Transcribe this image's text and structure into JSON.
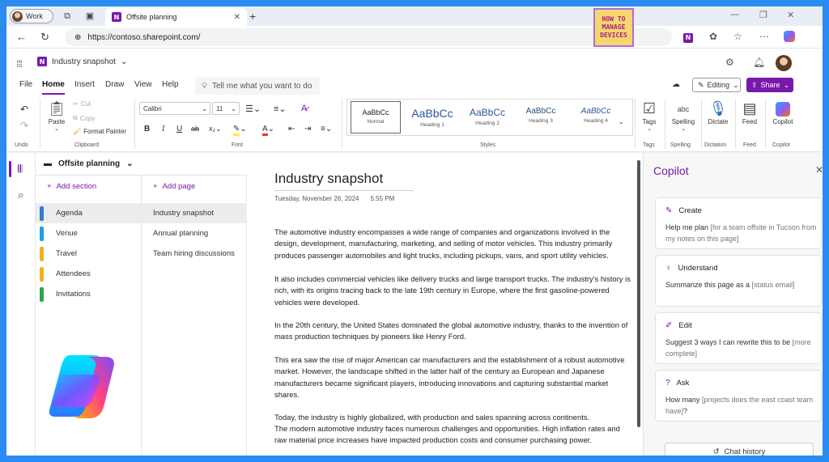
{
  "browser": {
    "profile_label": "Work",
    "tab_title": "Offsite planning",
    "url": "https://contoso.sharepoint.com/"
  },
  "watermark": {
    "line1": "HOW TO",
    "line2": "MANAGE",
    "line3": "DEVICES"
  },
  "app": {
    "title": "Industry snapshot",
    "menus": [
      "File",
      "Home",
      "Insert",
      "Draw",
      "View",
      "Help"
    ],
    "tell_me_placeholder": "Tell me what you want to do",
    "editing_label": "Editing",
    "share_label": "Share"
  },
  "ribbon": {
    "undo_group": "Undo",
    "paste_label": "Paste",
    "cut_label": "Cut",
    "copy_label": "Copy",
    "format_painter_label": "Format Painter",
    "clipboard_group": "Clipboard",
    "font_name": "Calibri",
    "font_size": "11",
    "font_group": "Font",
    "styles": [
      {
        "preview": "AaBbCc",
        "name": "Normal"
      },
      {
        "preview": "AaBbCc",
        "name": "Heading 1"
      },
      {
        "preview": "AaBbCc",
        "name": "Heading 2"
      },
      {
        "preview": "AaBbCc",
        "name": "Heading 3"
      },
      {
        "preview": "AaBbCc",
        "name": "Heading 4"
      }
    ],
    "styles_group": "Styles",
    "tags_label": "Tags",
    "tags_group": "Tags",
    "spelling_label": "Spelling",
    "spelling_group": "Spelling",
    "dictate_label": "Dictate",
    "dictation_group": "Dictation",
    "feed_label": "Feed",
    "feed_group": "Feed",
    "copilot_label": "Copilot",
    "copilot_group": "Copilot",
    "abc_text": "abc"
  },
  "notebook": {
    "name": "Offsite planning",
    "add_section": "Add section",
    "add_page": "Add page",
    "sections": [
      {
        "label": "Agenda",
        "color": "#2d7fd0"
      },
      {
        "label": "Venue",
        "color": "#1ba1e2"
      },
      {
        "label": "Travel",
        "color": "#f2b01e"
      },
      {
        "label": "Attendees",
        "color": "#f2b01e"
      },
      {
        "label": "Invitations",
        "color": "#2ea44f"
      }
    ],
    "pages": [
      "Industry snapshot",
      "Annual planning",
      "Team hiring discussions"
    ]
  },
  "page": {
    "title": "Industry snapshot",
    "date": "Tuesday, November 26, 2024",
    "time": "5:55 PM",
    "paragraphs": [
      "The automotive industry encompasses a wide range of companies and organizations involved in the design, development, manufacturing, marketing, and selling of motor vehicles. This industry primarily produces passenger automobiles and light trucks, including pickups, vans, and sport utility vehicles.",
      "It also includes commercial vehicles like delivery trucks and large transport trucks. The industry's history is rich, with its origins tracing back to the late 19th century in Europe, where the first gasoline-powered vehicles were developed.",
      "In the 20th century, the United States dominated the global automotive industry, thanks to the invention of mass production techniques by pioneers like Henry Ford.",
      "This era saw the rise of major American car manufacturers and the establishment of a robust automotive market. However, the landscape shifted in the latter half of the century as European and Japanese manufacturers became significant players, introducing innovations and capturing substantial market shares.",
      "Today, the industry is highly globalized, with production and sales spanning across continents.",
      "The modern automotive industry faces numerous challenges and opportunities. High inflation rates and raw material price increases have impacted production costs and consumer purchasing power."
    ]
  },
  "copilot": {
    "title": "Copilot",
    "cards": [
      {
        "heading": "Create",
        "text": "Help me plan ",
        "placeholder": "[for a team offsite in Tucson from my notes on this page]",
        "tail": ""
      },
      {
        "heading": "Understand",
        "text": "Summarize this page as a ",
        "placeholder": "[status email]",
        "tail": ""
      },
      {
        "heading": "Edit",
        "text": "Suggest 3 ways I can rewrite this to be ",
        "placeholder": "[more complete]",
        "tail": ""
      },
      {
        "heading": "Ask",
        "text": "How many ",
        "placeholder": "[projects does the east coast team have]",
        "tail": "?"
      }
    ],
    "chat_history": "Chat history"
  },
  "colors": {
    "accent": "#7719aa",
    "frame": "#2a8cf0"
  }
}
